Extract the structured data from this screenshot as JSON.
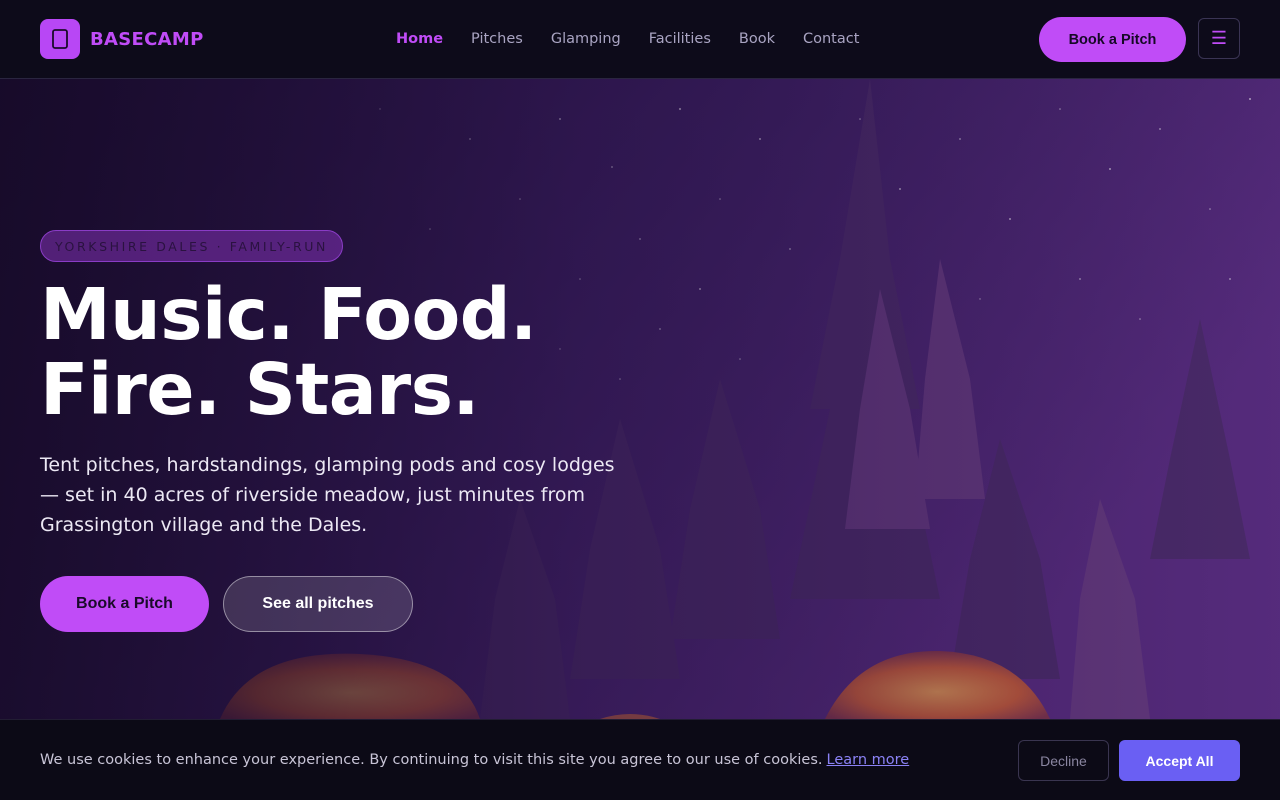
{
  "brand": {
    "name": "BASECAMP",
    "logo_icon": "tent-icon",
    "accent": "#c04cf7"
  },
  "nav": {
    "links": [
      {
        "label": "Home",
        "active": true
      },
      {
        "label": "Pitches",
        "active": false
      },
      {
        "label": "Glamping",
        "active": false
      },
      {
        "label": "Facilities",
        "active": false
      },
      {
        "label": "Book",
        "active": false
      },
      {
        "label": "Contact",
        "active": false
      }
    ],
    "cta_label": "Book a Pitch",
    "menu_icon": "☰"
  },
  "hero": {
    "eyebrow": "YORKSHIRE DALES · FAMILY-RUN",
    "headline_line1": "Music. Food.",
    "headline_line2": "Fire. Stars.",
    "lede": "Tent pitches, hardstandings, glamping pods and cosy lodges — set in 40 acres of riverside meadow, just minutes from Grassington village and the Dales.",
    "primary_label": "Book a Pitch",
    "secondary_label": "See all pitches"
  },
  "cookie": {
    "message": "We use cookies to enhance your experience. By continuing to visit this site you agree to our use of cookies.",
    "link_label": "Learn more",
    "decline_label": "Decline",
    "accept_label": "Accept All",
    "accept_color": "#6a5ff3"
  }
}
